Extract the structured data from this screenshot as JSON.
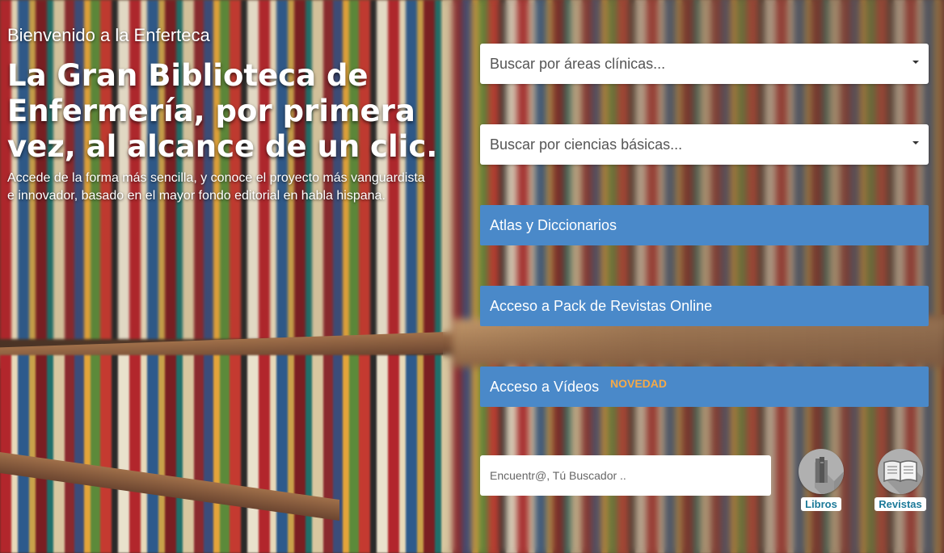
{
  "hero": {
    "welcome": "Bienvenido a la Enferteca",
    "headline": "La Gran Biblioteca de Enfermería, por primera vez, al alcance de un clic.",
    "subtext": "Accede de la forma más sencilla, y conoce el proyecto más vanguardista e innovador, basado en el mayor fondo editorial en habla hispana."
  },
  "filters": {
    "clinical": "Buscar por áreas clínicas...",
    "basic": "Buscar por ciencias básicas..."
  },
  "links": {
    "atlas": "Atlas y Diccionarios",
    "journals": "Acceso a Pack de Revistas Online",
    "videos": "Acceso a Vídeos",
    "videos_badge": "NOVEDAD"
  },
  "search": {
    "placeholder": "Encuentr@, Tú Buscador .."
  },
  "shortcuts": {
    "books": "Libros",
    "journals": "Revistas"
  },
  "colors": {
    "button": "#4a89c9",
    "badge": "#f4a948",
    "shortcut_text": "#1d7a99"
  },
  "icons": {
    "books": "books-icon",
    "journals": "open-magazine-icon",
    "dropdown": "caret-down-icon"
  }
}
